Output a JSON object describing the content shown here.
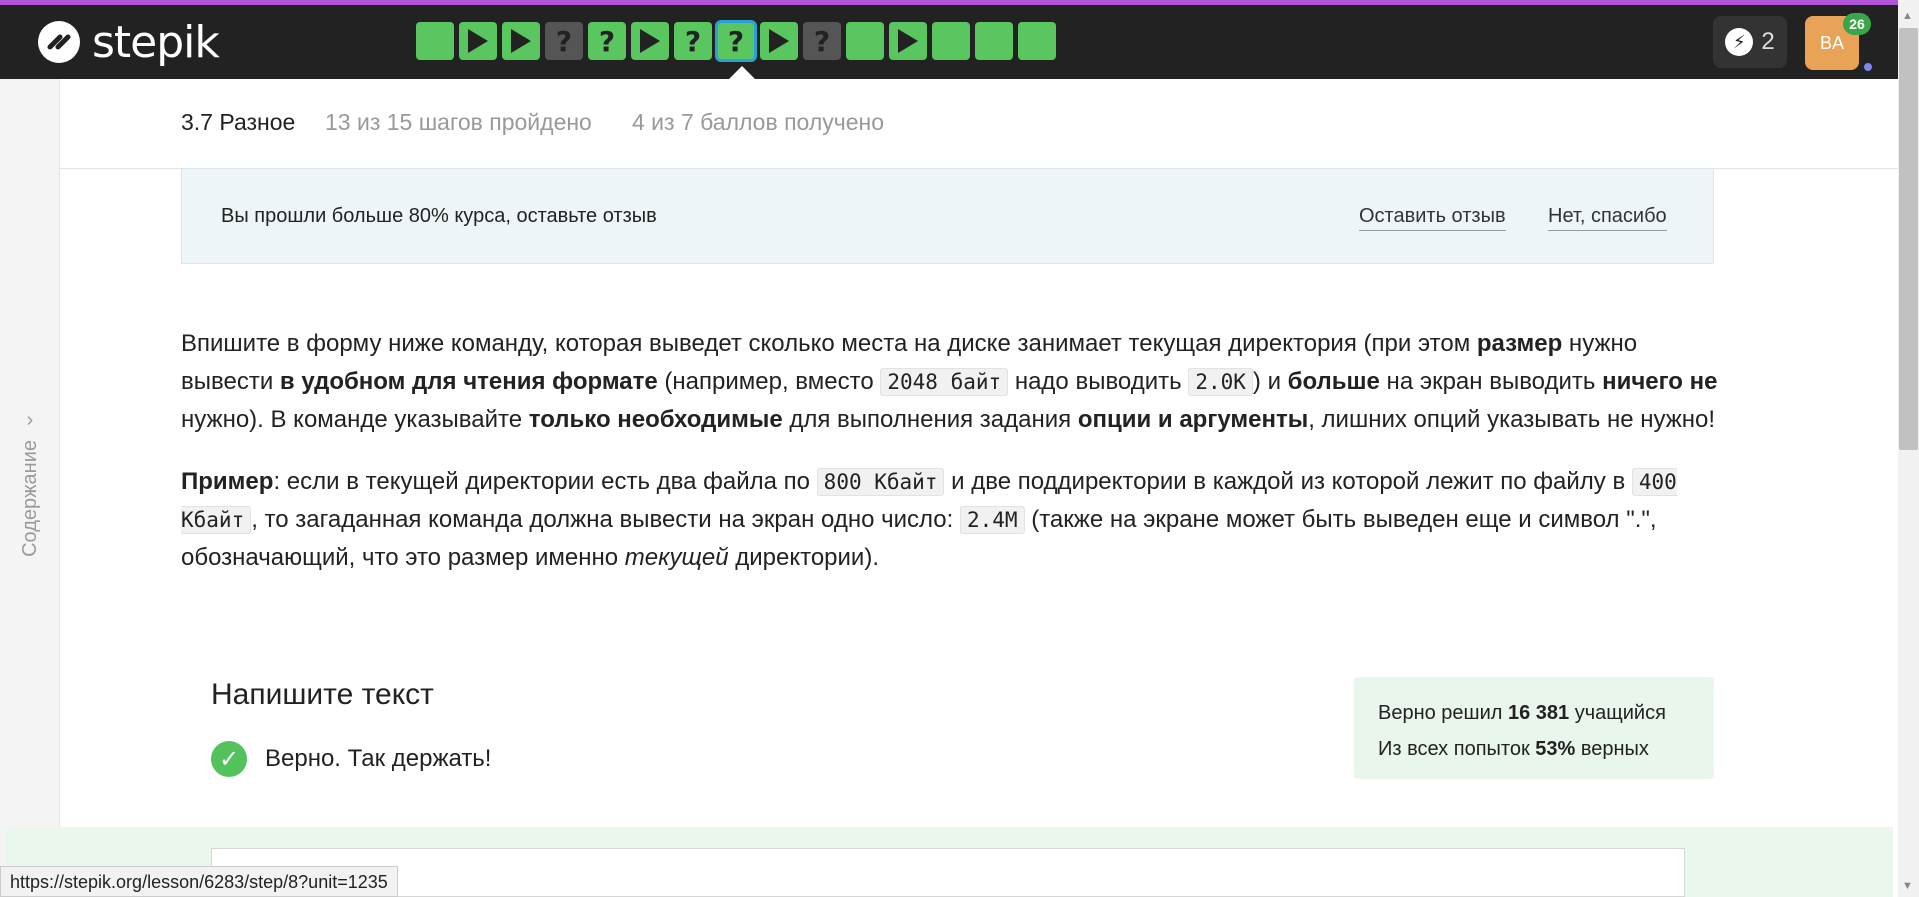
{
  "header": {
    "logo_text": "stepik",
    "steps": [
      {
        "kind": "text",
        "label": ""
      },
      {
        "kind": "video",
        "label": ""
      },
      {
        "kind": "video",
        "label": ""
      },
      {
        "kind": "quiz-gray",
        "label": "?"
      },
      {
        "kind": "quiz-green",
        "label": "?"
      },
      {
        "kind": "video",
        "label": ""
      },
      {
        "kind": "quiz-green",
        "label": "?"
      },
      {
        "kind": "quiz-green-active",
        "label": "?"
      },
      {
        "kind": "video",
        "label": ""
      },
      {
        "kind": "quiz-gray",
        "label": "?"
      },
      {
        "kind": "text",
        "label": ""
      },
      {
        "kind": "video",
        "label": ""
      },
      {
        "kind": "text",
        "label": ""
      },
      {
        "kind": "text",
        "label": ""
      },
      {
        "kind": "text",
        "label": ""
      }
    ],
    "energy_count": "2",
    "avatar_initials": "BA",
    "notification_count": "26"
  },
  "sidebar": {
    "toc_label": "Содержание"
  },
  "lesson": {
    "title": "3.7 Разное",
    "progress": "13 из 15 шагов пройдено",
    "score": "4 из 7 баллов  получено"
  },
  "feedback": {
    "text": "Вы прошли больше 80% курса, оставьте отзыв",
    "leave_review": "Оставить отзыв",
    "no_thanks": "Нет, спасибо"
  },
  "content": {
    "p1_a": "Впишите в форму ниже команду, которая выведет сколько места на диске занимает текущая директория (при этом ",
    "p1_b": "размер",
    "p1_c": " нужно вывести ",
    "p1_d": "в удобном для чтения формате",
    "p1_e": " (например, вместо ",
    "p1_code1": "2048 байт",
    "p1_f": " надо выводить ",
    "p1_code2": "2.0K",
    "p1_g": ") и ",
    "p1_h": "больше",
    "p1_i": " на экран выводить ",
    "p1_j": "ничего не",
    "p1_k": " нужно). В команде указывайте ",
    "p1_l": "только необходимые",
    "p1_m": " для выполнения задания ",
    "p1_n": "опции и аргументы",
    "p1_o": ", лишних опций указывать не нужно!",
    "p2_a": "Пример",
    "p2_b": ": если в текущей директории есть два файла по ",
    "p2_code1": "800 Кбайт",
    "p2_c": " и две поддиректории в каждой из которой лежит по файлу в ",
    "p2_code2": "400 Кбайт",
    "p2_d": ", то загаданная команда должна вывести на экран одно число: ",
    "p2_code3": "2.4M",
    "p2_e": " (также на экране может быть выведен еще и символ \".\", обозначающий, что это размер именно ",
    "p2_f": "текущей",
    "p2_g": " директории)."
  },
  "task": {
    "title": "Напишите текст",
    "status": "Верно. Так держать!"
  },
  "stats": {
    "line1_a": "Верно решил ",
    "line1_b": "16 381",
    "line1_c": " учащийся",
    "line2_a": "Из всех попыток ",
    "line2_b": "53%",
    "line2_c": " верных"
  },
  "status_url": "https://stepik.org/lesson/6283/step/8?unit=1235"
}
